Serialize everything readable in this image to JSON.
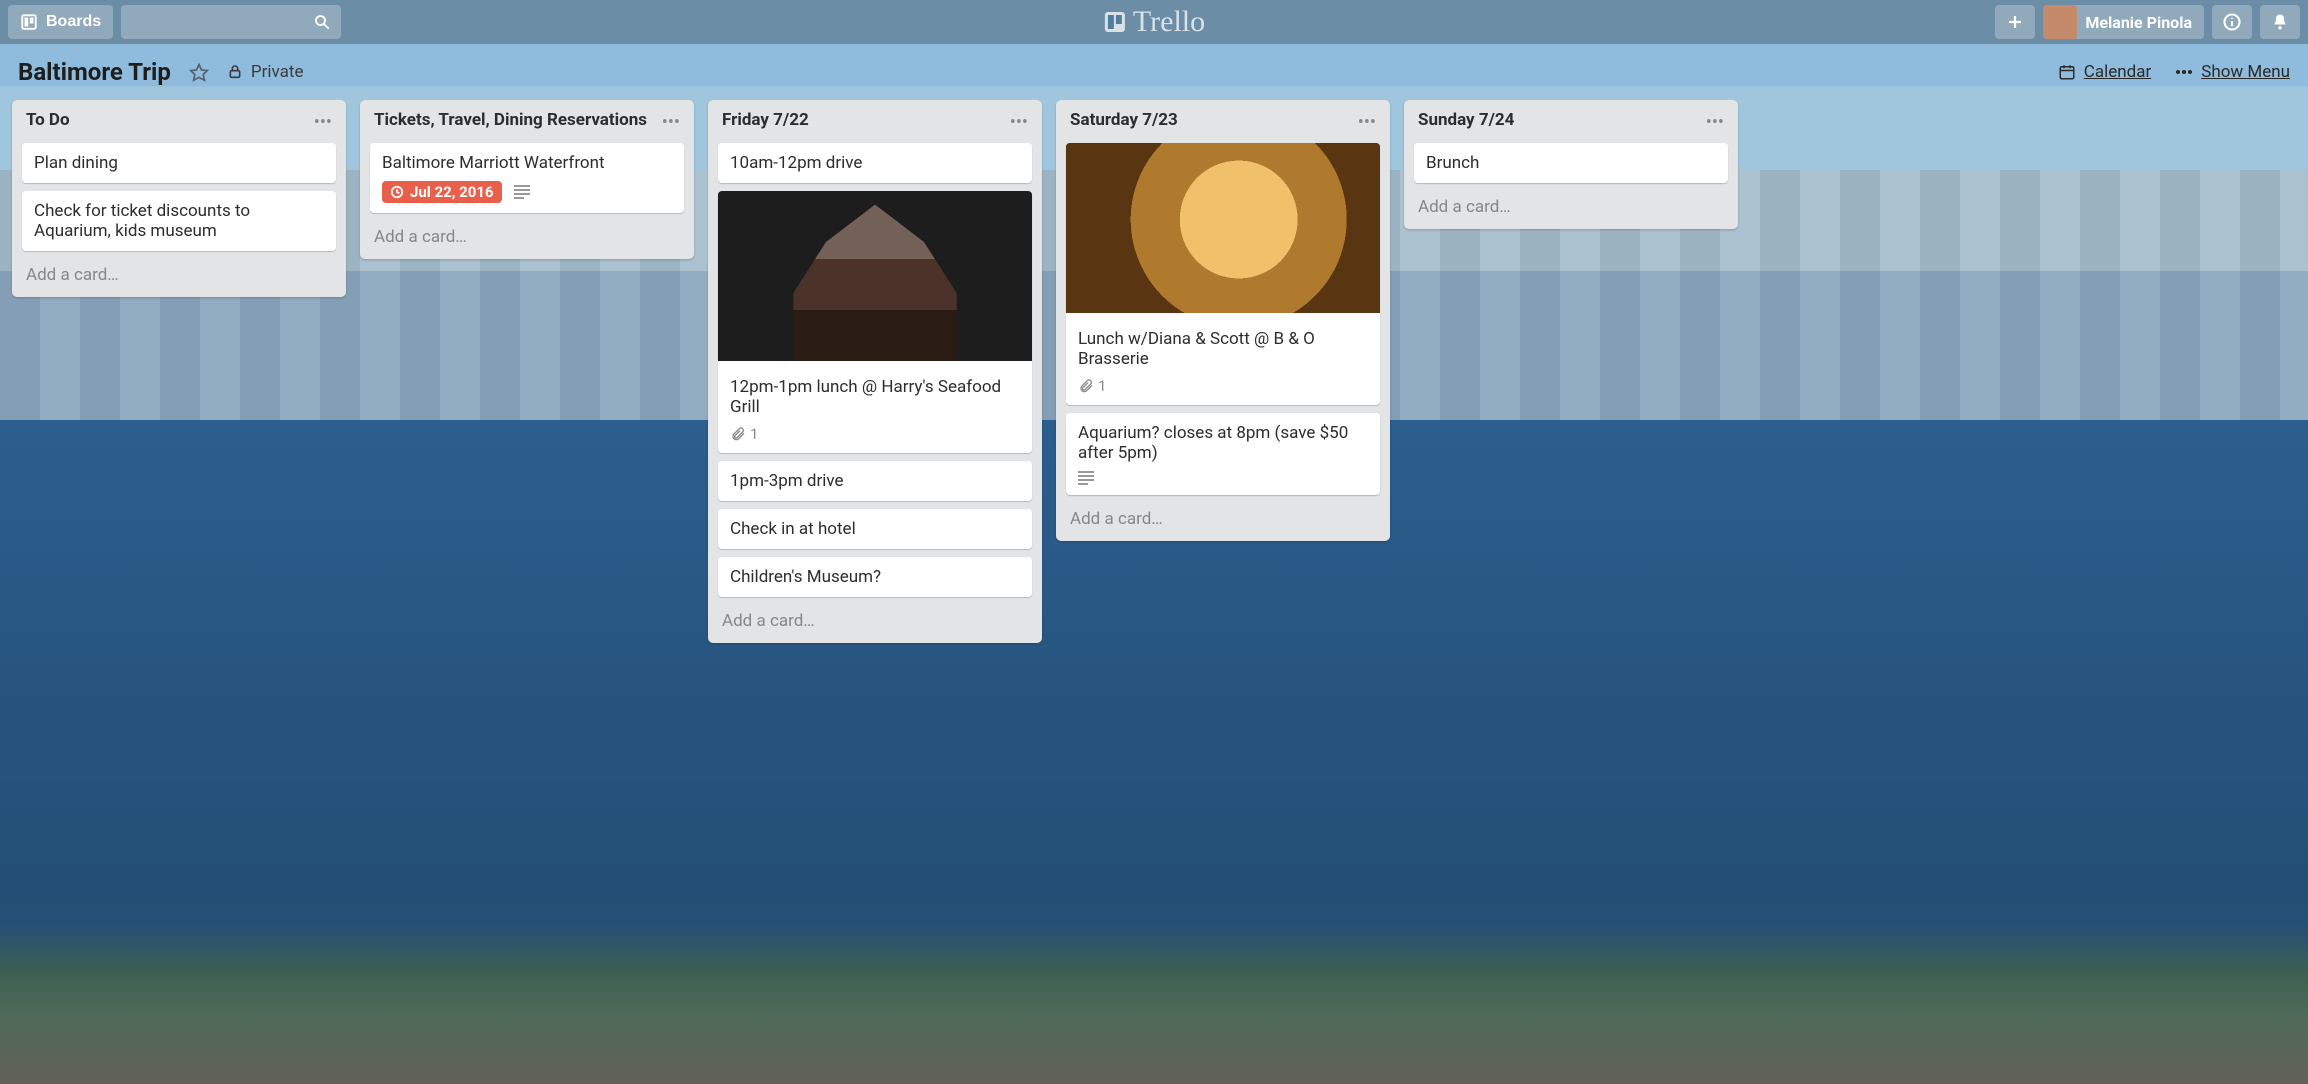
{
  "app": {
    "name": "Trello"
  },
  "topbar": {
    "boards_label": "Boards",
    "search_placeholder": "",
    "user_name": "Melanie Pinola"
  },
  "board_header": {
    "title": "Baltimore Trip",
    "privacy_label": "Private",
    "calendar_label": "Calendar",
    "show_menu_label": "Show Menu"
  },
  "add_card_label": "Add a card…",
  "lists": [
    {
      "title": "To Do",
      "cards": [
        {
          "text": "Plan dining"
        },
        {
          "text": "Check for ticket discounts to Aquarium, kids museum"
        }
      ]
    },
    {
      "title": "Tickets, Travel, Dining Reservations",
      "cards": [
        {
          "text": "Baltimore Marriott Waterfront",
          "due": "Jul 22, 2016",
          "has_description": true
        }
      ]
    },
    {
      "title": "Friday 7/22",
      "cards": [
        {
          "text": "10am-12pm drive"
        },
        {
          "text": "12pm-1pm lunch @ Harry's Seafood Grill",
          "cover": "a",
          "attachments": "1"
        },
        {
          "text": "1pm-3pm drive"
        },
        {
          "text": "Check in at hotel"
        },
        {
          "text": "Children's Museum?"
        }
      ]
    },
    {
      "title": "Saturday 7/23",
      "cards": [
        {
          "text": "Lunch w/Diana & Scott @ B & O Brasserie",
          "cover": "b",
          "attachments": "1"
        },
        {
          "text": "Aquarium? closes at 8pm (save $50 after 5pm)",
          "has_description": true
        }
      ]
    },
    {
      "title": "Sunday 7/24",
      "cards": [
        {
          "text": "Brunch"
        }
      ]
    }
  ]
}
